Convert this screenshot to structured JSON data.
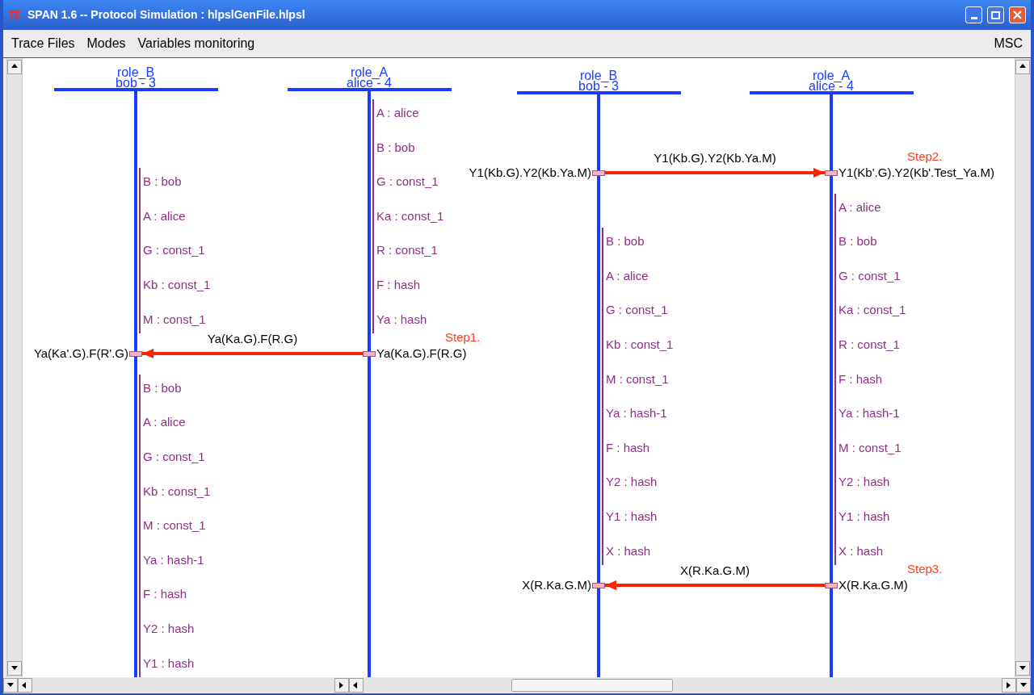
{
  "window": {
    "title": "SPAN 1.6 -- Protocol Simulation : hlpslGenFile.hlpsl"
  },
  "menu": {
    "left": [
      "Trace Files",
      "Modes",
      "Variables monitoring"
    ],
    "right": [
      "MSC"
    ]
  },
  "panels": [
    {
      "lifelines": [
        {
          "role": "role_B",
          "instance": "bob - 3"
        },
        {
          "role": "role_A",
          "instance": "alice - 4"
        }
      ],
      "sequence": [
        {
          "kind": "state",
          "left_vars": [
            "B : bob",
            "A : alice",
            "G : const_1",
            "Kb : const_1",
            "M : const_1"
          ],
          "right_vars": [
            "A : alice",
            "B : bob",
            "G : const_1",
            "Ka : const_1",
            "R : const_1",
            "F : hash",
            "Ya : hash"
          ]
        },
        {
          "kind": "message",
          "step": "Step1.",
          "points_left": true,
          "label": "Ya(Ka.G).F(R.G)",
          "terms": [
            "Ya(Ka'.G).F(R'.G)",
            "Ya(Ka.G).F(R.G)"
          ]
        },
        {
          "kind": "state",
          "left_vars": [
            "B : bob",
            "A : alice",
            "G : const_1",
            "Kb : const_1",
            "M : const_1",
            "Ya : hash-1",
            "F : hash",
            "Y2 : hash",
            "Y1 : hash"
          ]
        }
      ]
    },
    {
      "lifelines": [
        {
          "role": "role_B",
          "instance": "bob - 3"
        },
        {
          "role": "role_A",
          "instance": "alice - 4"
        }
      ],
      "sequence": [
        {
          "kind": "message",
          "step": "Step2.",
          "points_left": false,
          "label": "Y1(Kb.G).Y2(Kb.Ya.M)",
          "terms": [
            "Y1(Kb.G).Y2(Kb.Ya.M)",
            "Y1(Kb'.G).Y2(Kb'.Test_Ya.M)"
          ]
        },
        {
          "kind": "state",
          "left_vars": [
            "B : bob",
            "A : alice",
            "G : const_1",
            "Kb : const_1",
            "M : const_1",
            "Ya : hash-1",
            "F : hash",
            "Y2 : hash",
            "Y1 : hash",
            "X : hash"
          ],
          "right_vars": [
            "A : alice",
            "B : bob",
            "G : const_1",
            "Ka : const_1",
            "R : const_1",
            "F : hash",
            "Ya : hash-1",
            "M : const_1",
            "Y2 : hash",
            "Y1 : hash",
            "X : hash"
          ]
        },
        {
          "kind": "message",
          "step": "Step3.",
          "points_left": true,
          "label": "X(R.Ka.G.M)",
          "terms": [
            "X(R.Ka.G.M)",
            "X(R.Ka.G.M)"
          ]
        }
      ]
    }
  ]
}
